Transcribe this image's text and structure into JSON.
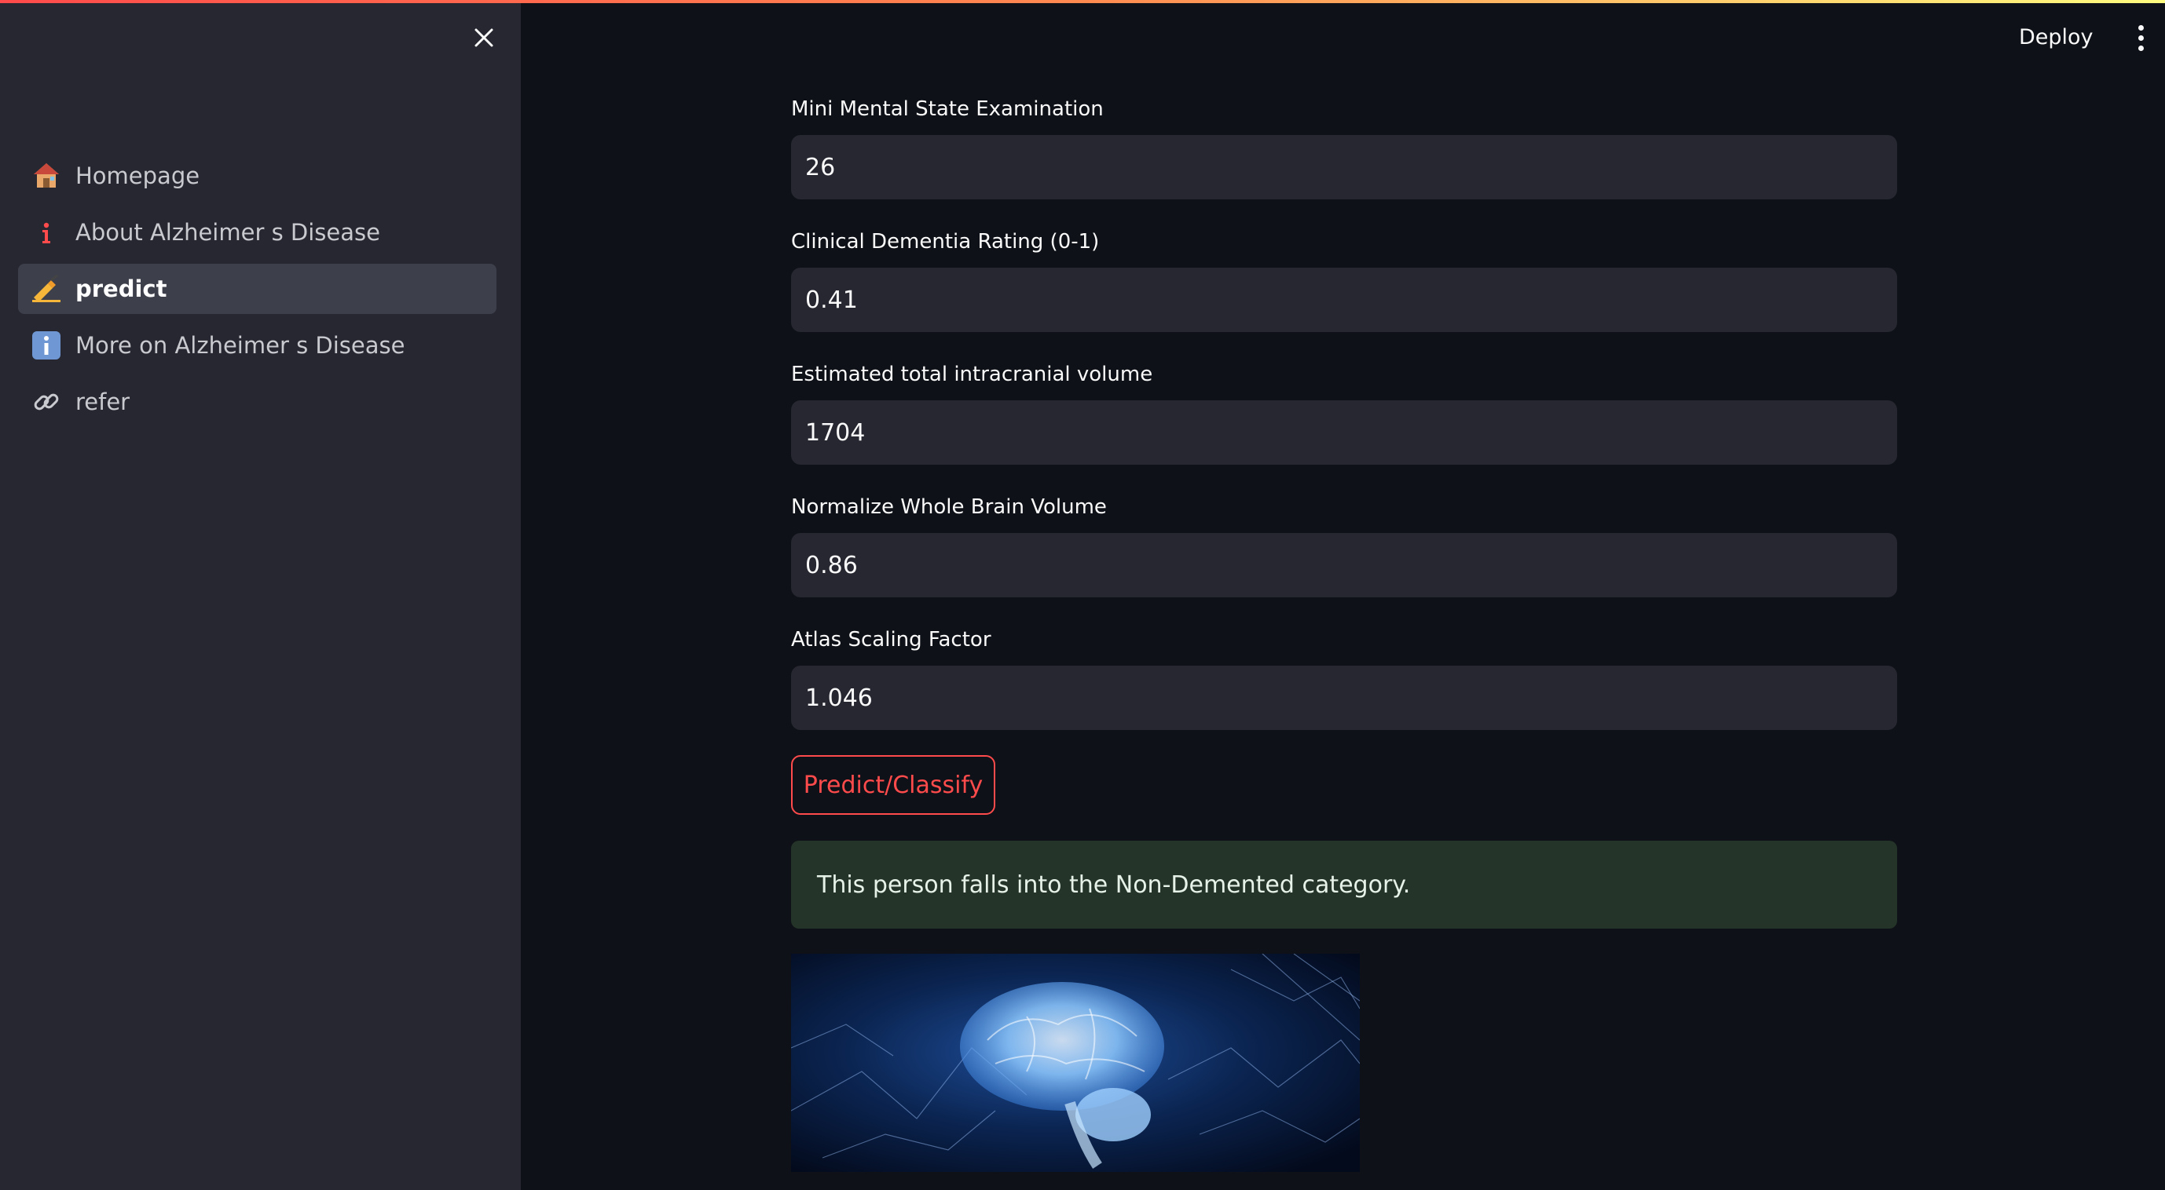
{
  "sidebar": {
    "close_icon": "close-icon",
    "items": [
      {
        "label": "Homepage",
        "icon": "house-icon",
        "active": false
      },
      {
        "label": "About Alzheimer s Disease",
        "icon": "info-icon",
        "active": false
      },
      {
        "label": "predict",
        "icon": "writing-hand-icon",
        "active": true
      },
      {
        "label": "More on Alzheimer s Disease",
        "icon": "info-box-icon",
        "active": false
      },
      {
        "label": "refer",
        "icon": "link-icon",
        "active": false
      }
    ]
  },
  "header": {
    "deploy_label": "Deploy",
    "menu_icon": "kebab-menu-icon"
  },
  "form": {
    "fields": [
      {
        "label": "Mini Mental State Examination",
        "value": "26"
      },
      {
        "label": "Clinical Dementia Rating (0-1)",
        "value": "0.41"
      },
      {
        "label": "Estimated total intracranial volume",
        "value": "1704"
      },
      {
        "label": "Normalize Whole Brain Volume",
        "value": "0.86"
      },
      {
        "label": "Atlas Scaling Factor",
        "value": "1.046"
      }
    ],
    "submit_label": "Predict/Classify"
  },
  "result": {
    "message": "This person falls into the Non-Demented category."
  },
  "colors": {
    "accent": "#ff4b4b",
    "background": "#0e1117",
    "sidebar": "#262730",
    "success_bg": "#243428"
  }
}
